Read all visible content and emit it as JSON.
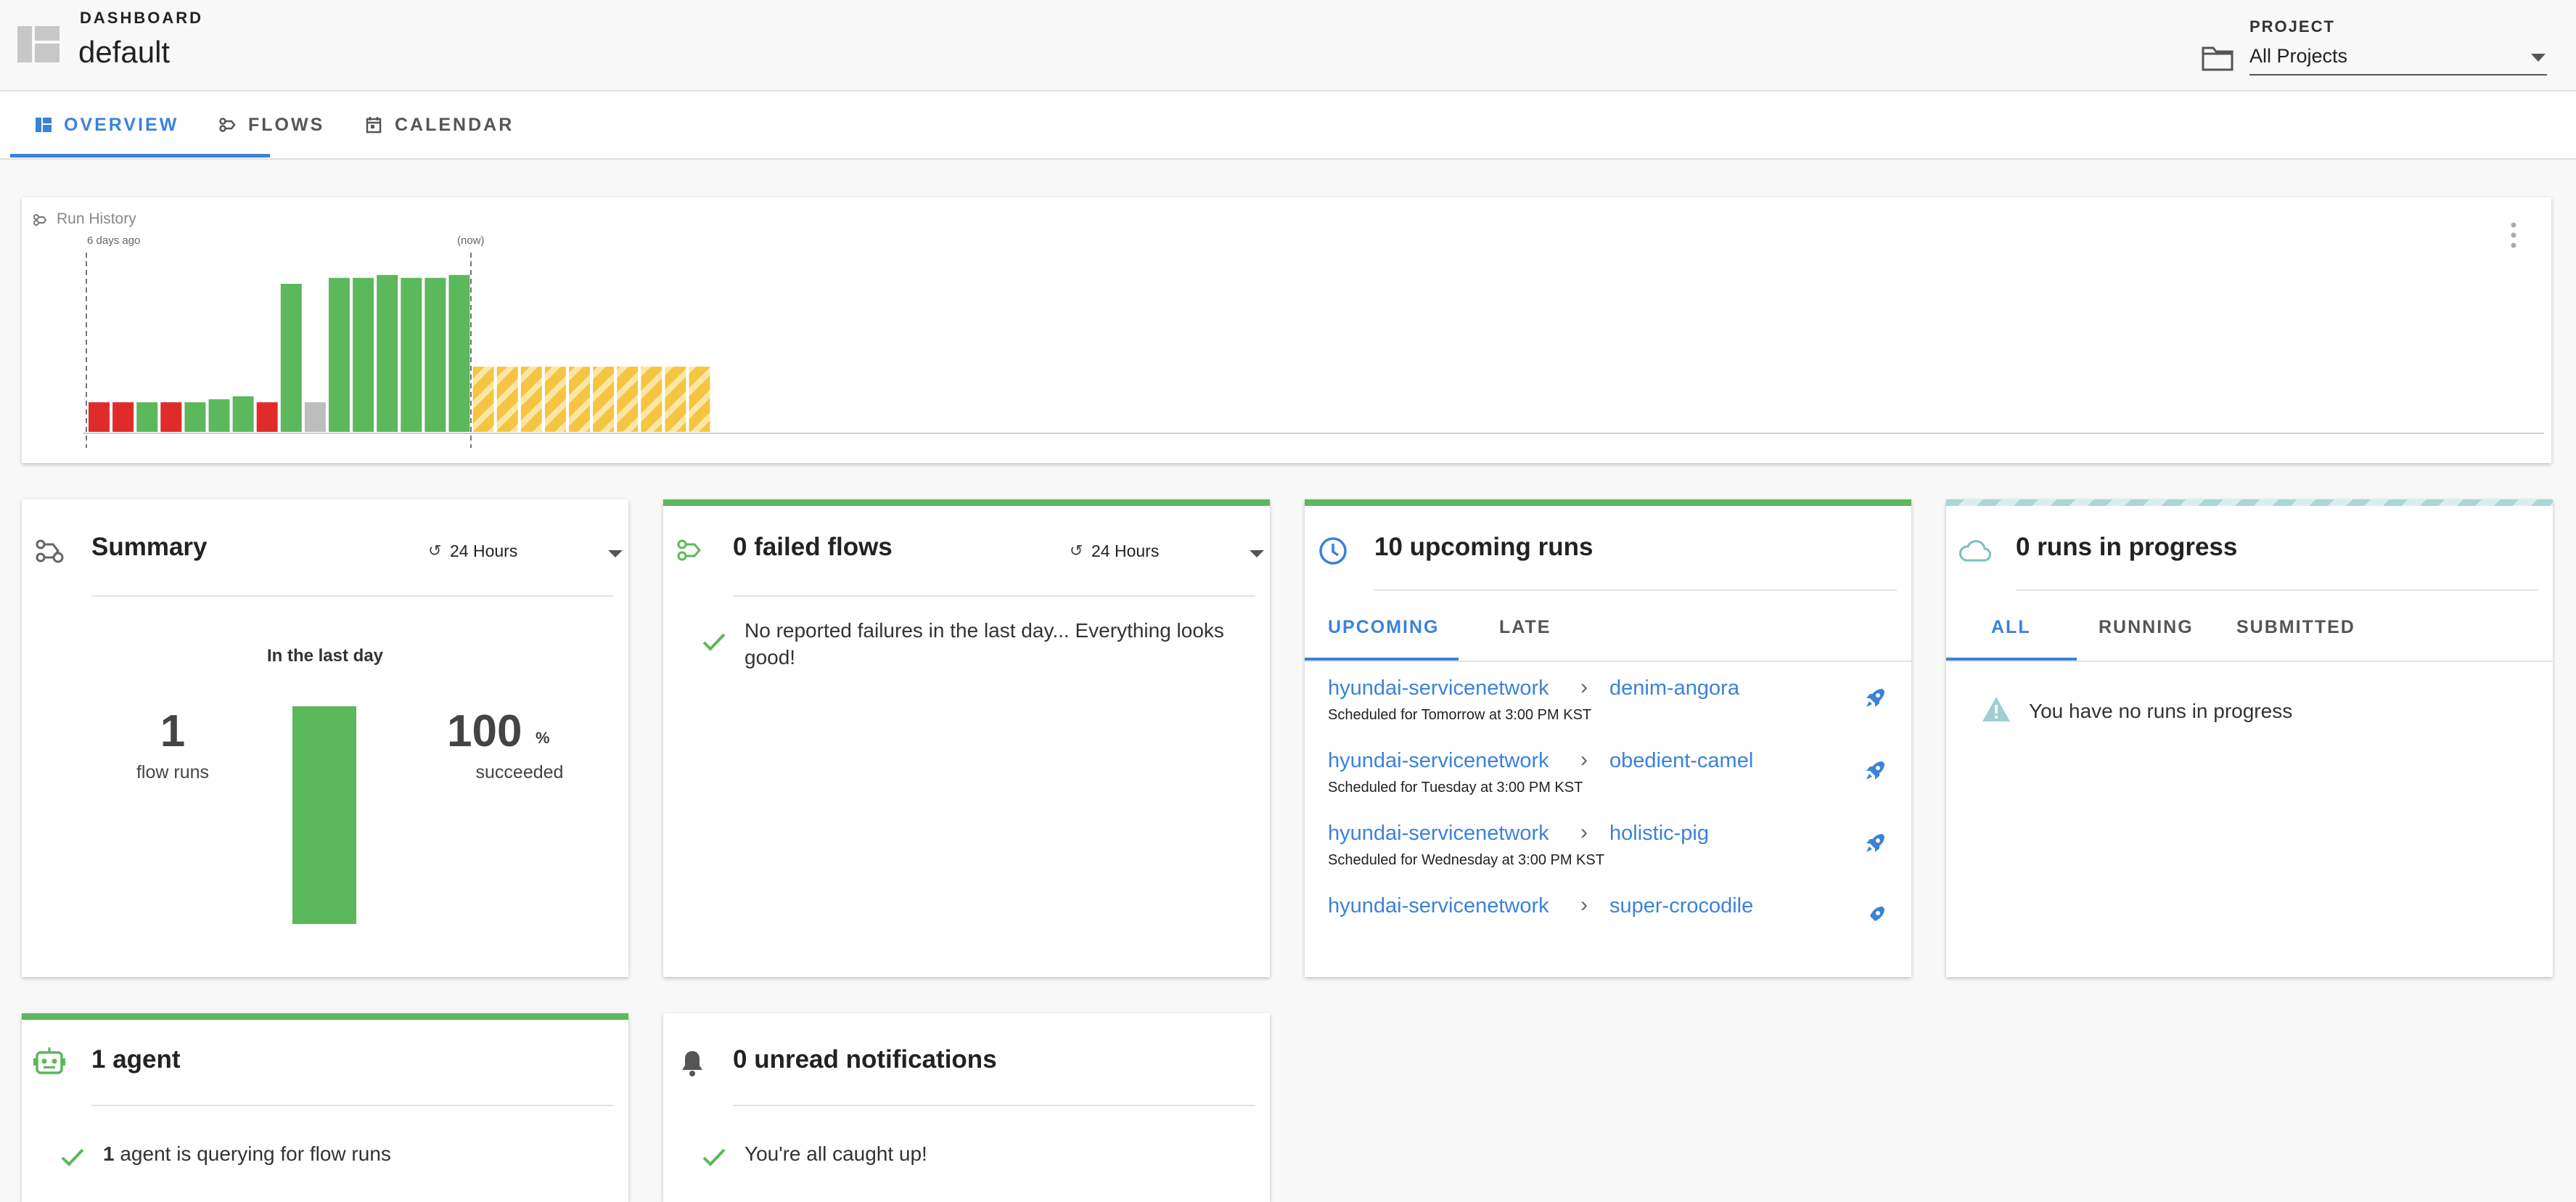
{
  "header": {
    "eyebrow": "DASHBOARD",
    "title": "default",
    "project_label": "PROJECT",
    "project_value": "All Projects"
  },
  "tabs": [
    {
      "label": "OVERVIEW",
      "icon": "dashboard-icon",
      "active": true
    },
    {
      "label": "FLOWS",
      "icon": "flows-icon",
      "active": false
    },
    {
      "label": "CALENDAR",
      "icon": "calendar-icon",
      "active": false
    }
  ],
  "run_history": {
    "title": "Run History",
    "start_label": "6 days ago",
    "now_label": "(now)"
  },
  "chart_data": {
    "type": "bar",
    "title": "Run History",
    "note": "relative heights; no numeric axis shown",
    "bars": [
      {
        "state": "failed",
        "value": 0.2
      },
      {
        "state": "failed",
        "value": 0.2
      },
      {
        "state": "success",
        "value": 0.2
      },
      {
        "state": "failed",
        "value": 0.2
      },
      {
        "state": "success",
        "value": 0.2
      },
      {
        "state": "success",
        "value": 0.22
      },
      {
        "state": "success",
        "value": 0.24
      },
      {
        "state": "failed",
        "value": 0.2
      },
      {
        "state": "success",
        "value": 1.0
      },
      {
        "state": "other",
        "value": 0.2
      },
      {
        "state": "success",
        "value": 1.04
      },
      {
        "state": "success",
        "value": 1.04
      },
      {
        "state": "success",
        "value": 1.06
      },
      {
        "state": "success",
        "value": 1.04
      },
      {
        "state": "success",
        "value": 1.04
      },
      {
        "state": "success",
        "value": 1.06
      },
      {
        "state": "scheduled",
        "value": 0.44
      },
      {
        "state": "scheduled",
        "value": 0.44
      },
      {
        "state": "scheduled",
        "value": 0.44
      },
      {
        "state": "scheduled",
        "value": 0.44
      },
      {
        "state": "scheduled",
        "value": 0.44
      },
      {
        "state": "scheduled",
        "value": 0.44
      },
      {
        "state": "scheduled",
        "value": 0.44
      },
      {
        "state": "scheduled",
        "value": 0.44
      },
      {
        "state": "scheduled",
        "value": 0.44
      },
      {
        "state": "scheduled",
        "value": 0.44
      }
    ],
    "colors": {
      "failed": "#e02b2b",
      "success": "#5cb85c",
      "other": "#bdbdbd",
      "scheduled": "#f5c542"
    }
  },
  "summary": {
    "title": "Summary",
    "range": "24 Hours",
    "caption": "In the last day",
    "flow_runs_value": "1",
    "flow_runs_label": "flow runs",
    "succeeded_value": "100",
    "succeeded_unit": "%",
    "succeeded_label": "succeeded",
    "success_fraction": 1.0
  },
  "failed": {
    "title": "0 failed flows",
    "range": "24 Hours",
    "message": "No reported failures in the last day... Everything looks good!"
  },
  "upcoming": {
    "title": "10 upcoming runs",
    "tabs": [
      "UPCOMING",
      "LATE"
    ],
    "runs": [
      {
        "flow": "hyundai-servicenetwork",
        "run": "denim-angora",
        "schedule": "Scheduled for Tomorrow at 3:00 PM KST"
      },
      {
        "flow": "hyundai-servicenetwork",
        "run": "obedient-camel",
        "schedule": "Scheduled for Tuesday at 3:00 PM KST"
      },
      {
        "flow": "hyundai-servicenetwork",
        "run": "holistic-pig",
        "schedule": "Scheduled for Wednesday at 3:00 PM KST"
      },
      {
        "flow": "hyundai-servicenetwork",
        "run": "super-crocodile",
        "schedule": ""
      }
    ],
    "separator": "›"
  },
  "in_progress": {
    "title": "0 runs in progress",
    "tabs": [
      "ALL",
      "RUNNING",
      "SUBMITTED"
    ],
    "message": "You have no runs in progress"
  },
  "agents": {
    "title": "1 agent",
    "count": "1",
    "message": " agent is querying for flow runs"
  },
  "notifications": {
    "title": "0 unread notifications",
    "message": "You're all caught up!"
  },
  "colors": {
    "accent": "#3b82d9",
    "success": "#5cb85c",
    "teal": "#7fbfbf"
  }
}
